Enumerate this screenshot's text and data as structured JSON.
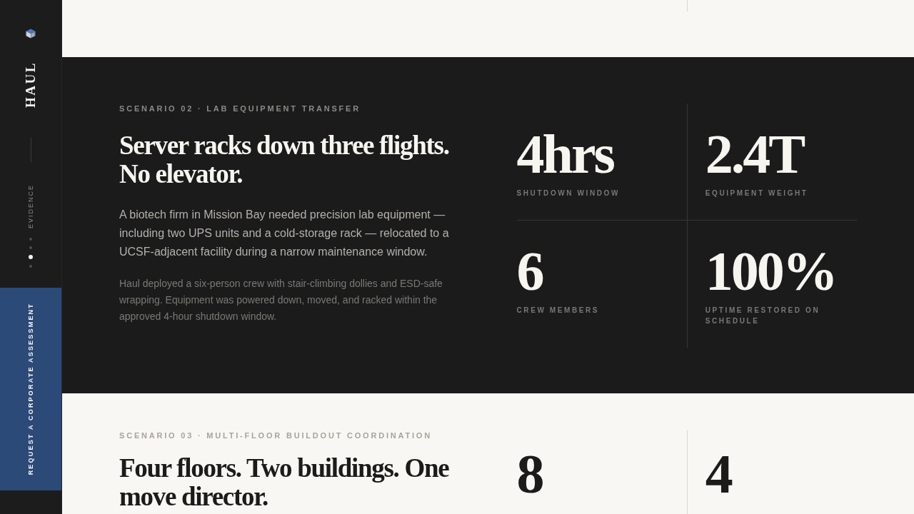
{
  "sidebar": {
    "brand": "HAUL",
    "section_label": "EVIDENCE",
    "section_dots": [
      {
        "selected": false
      },
      {
        "selected": false
      },
      {
        "selected": true
      },
      {
        "selected": false
      }
    ],
    "cta": "REQUEST A CORPORATE ASSESSMENT"
  },
  "scenarios": [
    {
      "kind": "tail"
    },
    {
      "kind": "dark",
      "eyebrow": "SCENARIO 02 · LAB EQUIPMENT TRANSFER",
      "heading": "Server racks down three flights. No elevator.",
      "paragraphs": [
        "A biotech firm in Mission Bay needed precision lab equipment — including two UPS units and a cold-storage rack — relocated to a UCSF-adjacent facility during a narrow maintenance window.",
        "Haul deployed a six-person crew with stair-climbing dollies and ESD-safe wrapping. Equipment was powered down, moved, and racked within the approved 4-hour shutdown window."
      ],
      "stats": [
        {
          "value": "4hrs",
          "label": "SHUTDOWN WINDOW"
        },
        {
          "value": "2.4T",
          "label": "EQUIPMENT WEIGHT"
        },
        {
          "value": "6",
          "label": "CREW MEMBERS"
        },
        {
          "value": "100%",
          "label": "UPTIME RESTORED ON SCHEDULE"
        }
      ]
    },
    {
      "kind": "light",
      "eyebrow": "SCENARIO 03 · MULTI-FLOOR BUILDOUT COORDINATION",
      "heading": "Four floors. Two buildings. One move director.",
      "stats": [
        {
          "value": "8"
        },
        {
          "value": "4"
        }
      ]
    }
  ]
}
